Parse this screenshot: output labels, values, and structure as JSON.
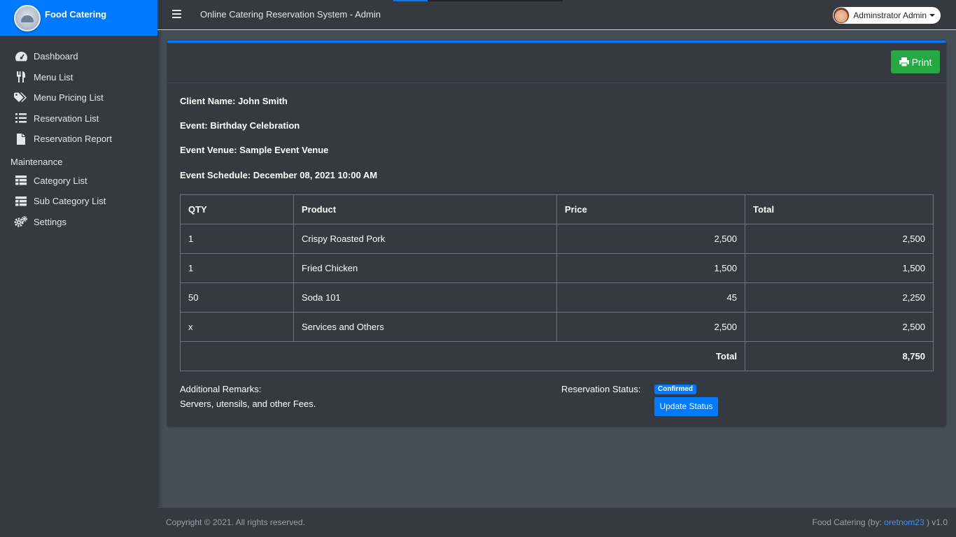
{
  "app": {
    "brand_name": "Food Catering",
    "system_title": "Online Catering Reservation System - Admin",
    "user_name": "Adminstrator Admin"
  },
  "sidebar": {
    "items": [
      {
        "label": "Dashboard",
        "icon": "dashboard-icon"
      },
      {
        "label": "Menu List",
        "icon": "utensils-icon"
      },
      {
        "label": "Menu Pricing List",
        "icon": "tags-icon"
      },
      {
        "label": "Reservation List",
        "icon": "list-icon"
      },
      {
        "label": "Reservation Report",
        "icon": "file-icon"
      }
    ],
    "section_header": "Maintenance",
    "maintenance_items": [
      {
        "label": "Category List",
        "icon": "table-icon"
      },
      {
        "label": "Sub Category List",
        "icon": "table-icon"
      },
      {
        "label": "Settings",
        "icon": "cogs-icon"
      }
    ]
  },
  "card": {
    "print_label": "Print",
    "client_name": "Client Name: John Smith",
    "event": "Event: Birthday Celebration",
    "venue": "Event Venue: Sample Event Venue",
    "schedule": "Event Schedule: December 08, 2021 10:00 AM",
    "table": {
      "headers": [
        "QTY",
        "Product",
        "Price",
        "Total"
      ],
      "rows": [
        {
          "qty": "1",
          "product": "Crispy Roasted Pork",
          "price": "2,500",
          "total": "2,500"
        },
        {
          "qty": "1",
          "product": "Fried Chicken",
          "price": "1,500",
          "total": "1,500"
        },
        {
          "qty": "50",
          "product": "Soda 101",
          "price": "45",
          "total": "2,250"
        },
        {
          "qty": "x",
          "product": "Services and Others",
          "price": "2,500",
          "total": "2,500"
        }
      ],
      "total_label": "Total",
      "grand_total": "8,750"
    },
    "remarks_label": "Additional Remarks:",
    "remarks_value": "Servers, utensils, and other Fees.",
    "status_label": "Reservation Status:",
    "status_badge": "Confirmed",
    "update_status_label": "Update Status"
  },
  "footer": {
    "copyright": "Copyright © 2021. All rights reserved.",
    "credit_prefix": "Food Catering (by: ",
    "credit_author": "oretnom23",
    "credit_suffix": " ) v1.0"
  },
  "colors": {
    "accent": "#007bff",
    "success": "#28a745",
    "sidebar_bg": "#343a40",
    "content_bg": "#454d55"
  }
}
